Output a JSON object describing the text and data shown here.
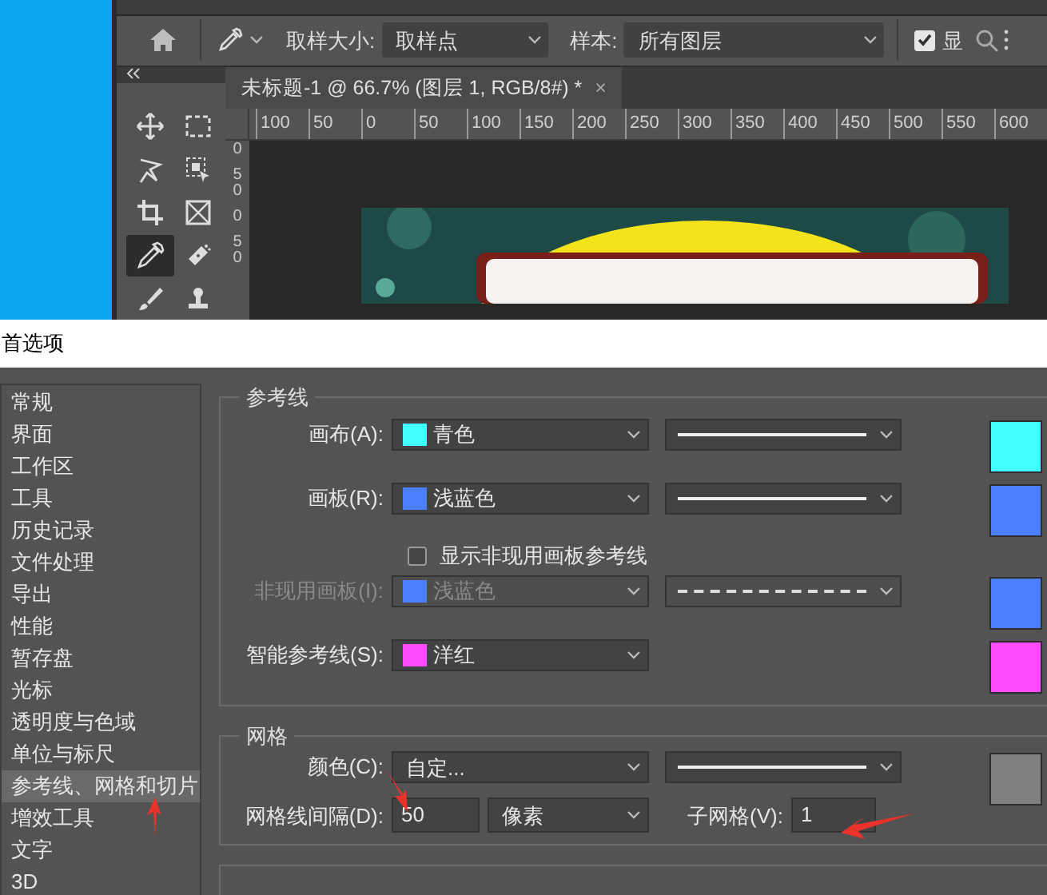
{
  "options_bar": {
    "sample_size_label": "取样大小:",
    "sample_size": "取样点",
    "sample_label": "样本:",
    "sample": "所有图层",
    "show_ring": {
      "label": "显",
      "checked": true
    }
  },
  "tools": [
    {
      "kind": "move",
      "selected": false
    },
    {
      "kind": "marquee",
      "selected": false
    },
    {
      "kind": "lasso",
      "selected": false
    },
    {
      "kind": "object-select",
      "selected": false
    },
    {
      "kind": "crop",
      "selected": false
    },
    {
      "kind": "frame",
      "selected": false
    },
    {
      "kind": "eyedropper",
      "selected": true
    },
    {
      "kind": "healing",
      "selected": false
    },
    {
      "kind": "brush",
      "selected": false
    },
    {
      "kind": "stamp",
      "selected": false
    }
  ],
  "document_tab": {
    "title": "未标题-1 @ 66.7% (图层 1, RGB/8#) *",
    "close": "×"
  },
  "rulers": {
    "horizontal": [
      "100",
      "50",
      "0",
      "50",
      "100",
      "150",
      "200",
      "250",
      "300",
      "350",
      "400",
      "450",
      "500",
      "550",
      "600"
    ],
    "vertical": [
      "0",
      "50",
      "0",
      "50"
    ]
  },
  "dialog": {
    "title": "首选项",
    "sidebar": [
      {
        "label": "常规",
        "selected": false
      },
      {
        "label": "界面",
        "selected": false
      },
      {
        "label": "工作区",
        "selected": false
      },
      {
        "label": "工具",
        "selected": false
      },
      {
        "label": "历史记录",
        "selected": false
      },
      {
        "label": "文件处理",
        "selected": false
      },
      {
        "label": "导出",
        "selected": false
      },
      {
        "label": "性能",
        "selected": false
      },
      {
        "label": "暂存盘",
        "selected": false
      },
      {
        "label": "光标",
        "selected": false
      },
      {
        "label": "透明度与色域",
        "selected": false
      },
      {
        "label": "单位与标尺",
        "selected": false
      },
      {
        "label": "参考线、网格和切片",
        "selected": true
      },
      {
        "label": "增效工具",
        "selected": false
      },
      {
        "label": "文字",
        "selected": false
      },
      {
        "label": "3D",
        "selected": false
      }
    ],
    "guides": {
      "title": "参考线",
      "rows": [
        {
          "kind": "guide",
          "label": "画布(A):",
          "value": "青色",
          "color": "#44ffff",
          "dashed": false,
          "disabled": false
        },
        {
          "kind": "guide",
          "label": "画板(R):",
          "value": "浅蓝色",
          "color": "#4a80ff",
          "dashed": false,
          "disabled": false
        },
        {
          "kind": "checkbox",
          "label": "显示非现用画板参考线",
          "checked": false
        },
        {
          "kind": "guide",
          "label": "非现用画板(I):",
          "value": "浅蓝色",
          "color": "#4a80ff",
          "dashed": true,
          "disabled": true
        },
        {
          "kind": "smart",
          "label": "智能参考线(S):",
          "value": "洋红",
          "color": "#ff4cff",
          "disabled": false
        }
      ]
    },
    "grid": {
      "title": "网格",
      "color_label": "颜色(C):",
      "color_value": "自定...",
      "dashed": false,
      "color": "#808080",
      "spacing_label": "网格线间隔(D):",
      "spacing": "50",
      "unit": "像素",
      "subdivisions_label": "子网格(V):",
      "subdivisions": "1"
    }
  }
}
